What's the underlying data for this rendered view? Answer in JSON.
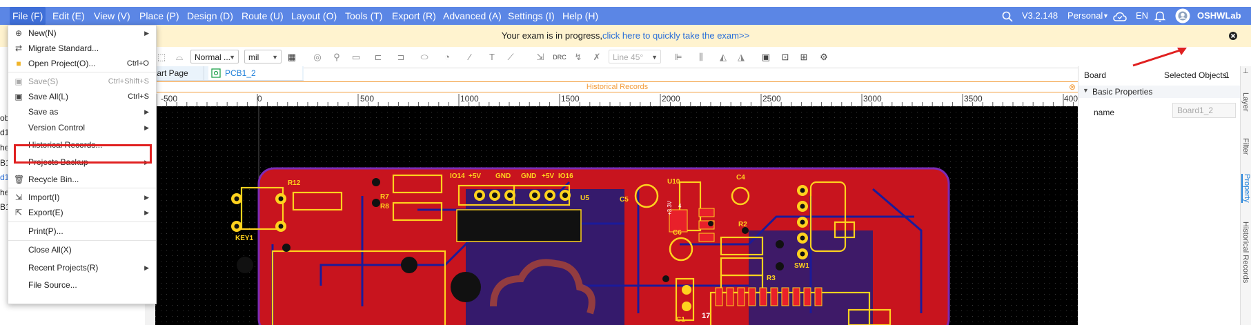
{
  "menubar": {
    "items": [
      "File (F)",
      "Edit (E)",
      "View (V)",
      "Place (P)",
      "Design (D)",
      "Route (U)",
      "Layout (O)",
      "Tools (T)",
      "Export (R)",
      "Advanced (A)",
      "Settings (I)",
      "Help (H)"
    ],
    "version": "V3.2.148",
    "edition": "Personal",
    "language": "EN",
    "username": "OSHWLab",
    "icons": [
      "search-icon",
      "cloud-icon",
      "bell-icon",
      "avatar"
    ]
  },
  "notice": {
    "text": "Your exam is in progress,",
    "link": "click here to quickly take the exam>>"
  },
  "toolbar": {
    "mode": "Normal ...",
    "unit": "mil",
    "line_angle": "Line 45°"
  },
  "tabs": [
    {
      "label": "Start Page"
    },
    {
      "label": "PCB1_2"
    }
  ],
  "historical_bar": {
    "title": "Historical Records"
  },
  "ruler": {
    "labels": [
      "-500",
      "0",
      "500",
      "1000",
      "1500",
      "2000",
      "2500",
      "3000",
      "3500",
      "400"
    ]
  },
  "left_partial": [
    "ob",
    "d1",
    "he",
    "B1",
    "d1",
    "he",
    "B1"
  ],
  "right_panel": {
    "board": "Board",
    "selected_label": "Selected Objects",
    "selected_count": "1",
    "section": "Basic Properties",
    "name_label": "name",
    "name_value": "Board1_2"
  },
  "rail_tabs": [
    "Layer",
    "Filter",
    "Property",
    "Historical Records"
  ],
  "file_menu": {
    "items": [
      {
        "label": "New(N)",
        "shortcut": "",
        "submenu": true,
        "disabled": false,
        "icon": "new-file-icon"
      },
      {
        "label": "Migrate Standard...",
        "shortcut": "",
        "submenu": false,
        "disabled": false,
        "icon": "migrate-icon"
      },
      {
        "label": "Open Project(O)...",
        "shortcut": "Ctrl+O",
        "submenu": false,
        "disabled": false,
        "icon": "folder-icon"
      },
      {
        "label": "Save(S)",
        "shortcut": "Ctrl+Shift+S",
        "submenu": false,
        "disabled": true,
        "icon": "save-icon"
      },
      {
        "label": "Save All(L)",
        "shortcut": "Ctrl+S",
        "submenu": false,
        "disabled": false,
        "icon": "save-all-icon"
      },
      {
        "label": "Save as",
        "shortcut": "",
        "submenu": true,
        "disabled": false,
        "icon": ""
      },
      {
        "label": "Version Control",
        "shortcut": "",
        "submenu": true,
        "disabled": false,
        "icon": ""
      },
      {
        "label": "Historical Records...",
        "shortcut": "",
        "submenu": false,
        "disabled": false,
        "icon": ""
      },
      {
        "label": "Projects Backup",
        "shortcut": "",
        "submenu": true,
        "disabled": false,
        "icon": ""
      },
      {
        "label": "Recycle Bin...",
        "shortcut": "",
        "submenu": false,
        "disabled": false,
        "icon": "trash-icon"
      },
      {
        "label": "Import(I)",
        "shortcut": "",
        "submenu": true,
        "disabled": false,
        "icon": "import-icon"
      },
      {
        "label": "Export(E)",
        "shortcut": "",
        "submenu": true,
        "disabled": false,
        "icon": "export-icon"
      },
      {
        "label": "Print(P)...",
        "shortcut": "",
        "submenu": false,
        "disabled": false,
        "icon": ""
      },
      {
        "label": "Close All(X)",
        "shortcut": "",
        "submenu": false,
        "disabled": false,
        "icon": ""
      },
      {
        "label": "Recent Projects(R)",
        "shortcut": "",
        "submenu": true,
        "disabled": false,
        "icon": ""
      },
      {
        "label": "File Source...",
        "shortcut": "",
        "submenu": false,
        "disabled": false,
        "icon": ""
      }
    ]
  },
  "pcb_labels": [
    "R12",
    "IO14",
    "+5V",
    "GND",
    "GND",
    "+5V",
    "IO16",
    "U5",
    "C4",
    "U10",
    "C5",
    "R7",
    "R8",
    "KEY1",
    "C6",
    "R2",
    "SW1",
    "R3",
    "C1",
    "17",
    "+3.3V",
    "4"
  ],
  "colors": {
    "menubar": "#5b86e5",
    "notice_bg": "#fff3cf",
    "highlight_box": "#e02020",
    "board": "#c8141e",
    "silkscreen": "#ffd21e",
    "canvas": "#000000",
    "history_accent": "#f39c3a"
  }
}
